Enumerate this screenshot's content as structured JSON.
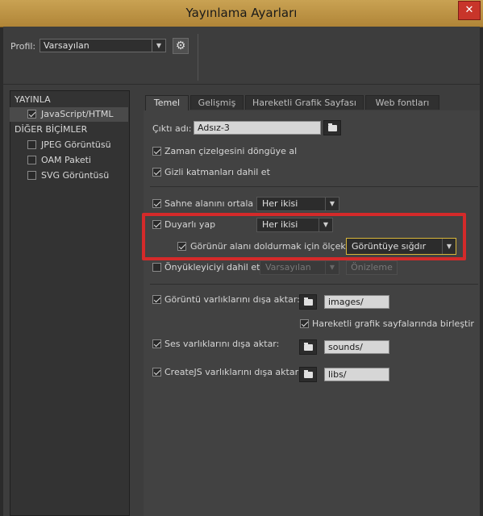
{
  "window": {
    "title": "Yayınlama Ayarları",
    "close_label": "✕"
  },
  "profile": {
    "label": "Profil:",
    "value": "Varsayılan"
  },
  "left_panel": {
    "publish_header": "YAYINLA",
    "publish_items": [
      {
        "label": "JavaScript/HTML",
        "checked": true
      }
    ],
    "other_header": "DİĞER BİÇİMLER",
    "other_items": [
      {
        "label": "JPEG Görüntüsü",
        "checked": false
      },
      {
        "label": "OAM Paketi",
        "checked": false
      },
      {
        "label": "SVG Görüntüsü",
        "checked": false
      }
    ]
  },
  "tabs": [
    "Temel",
    "Gelişmiş",
    "Hareketli Grafik Sayfası",
    "Web fontları"
  ],
  "basic": {
    "output_label": "Çıktı adı:",
    "output_value": "Adsız-3",
    "loop_timeline": "Zaman çizelgesini döngüye al",
    "include_hidden": "Gizli katmanları dahil et",
    "center_stage": "Sahne alanını ortala",
    "center_stage_value": "Her ikisi",
    "responsive": "Duyarlı yap",
    "responsive_value": "Her ikisi",
    "scale_fill": "Görünür alanı doldurmak için ölçekle",
    "scale_fill_value": "Görüntüye sığdır",
    "preloader": "Önyükleyiciyi dahil et",
    "preloader_value": "Varsayılan",
    "preview_label": "Önizleme",
    "export_images": "Görüntü varlıklarını dışa aktar:",
    "images_path": "images/",
    "combine_spritesheets": "Hareketli grafik sayfalarında birleştir",
    "export_sounds": "Ses varlıklarını dışa aktar:",
    "sounds_path": "sounds/",
    "export_createjs": "CreateJS varlıklarını dışa aktar:",
    "libs_path": "libs/"
  },
  "colors": {
    "title_bar": "#c39a4b",
    "highlight_border": "#d42a2a",
    "dropdown_focus": "#d8b63a"
  }
}
